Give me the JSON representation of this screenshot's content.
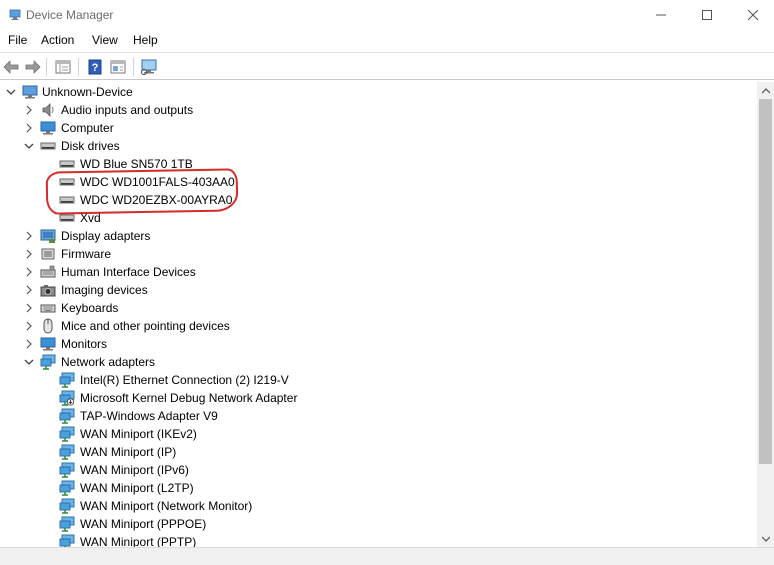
{
  "window": {
    "title": "Device Manager",
    "icon": "device-manager-icon",
    "controls": [
      "minimize-icon",
      "maximize-icon",
      "close-icon"
    ]
  },
  "menu": {
    "file": "File",
    "action": "Action",
    "view": "View",
    "help": "Help"
  },
  "toolbar": {
    "buttons": [
      "back-arrow-icon",
      "forward-arrow-icon",
      "properties-icon",
      "help-icon",
      "show-hidden-icon",
      "monitor-scan-icon"
    ]
  },
  "tree": {
    "root": "Unknown-Device",
    "categories": {
      "audio": "Audio inputs and outputs",
      "computer": "Computer",
      "disk_drives": "Disk drives",
      "display": "Display adapters",
      "firmware": "Firmware",
      "hid": "Human Interface Devices",
      "imaging": "Imaging devices",
      "keyboards": "Keyboards",
      "mice": "Mice and other pointing devices",
      "monitors": "Monitors",
      "network": "Network adapters"
    },
    "disks": [
      "WD Blue SN570 1TB",
      "WDC WD1001FALS-403AA0",
      "WDC WD20EZBX-00AYRA0",
      "Xvd"
    ],
    "network_devices": [
      "Intel(R) Ethernet Connection (2) I219-V",
      "Microsoft Kernel Debug Network Adapter",
      "TAP-Windows Adapter V9",
      "WAN Miniport (IKEv2)",
      "WAN Miniport (IP)",
      "WAN Miniport (IPv6)",
      "WAN Miniport (L2TP)",
      "WAN Miniport (Network Monitor)",
      "WAN Miniport (PPPOE)",
      "WAN Miniport (PPTP)"
    ]
  },
  "colors": {
    "annotation": "#d42b2b",
    "monitor_blue": "#3a8fd6"
  }
}
